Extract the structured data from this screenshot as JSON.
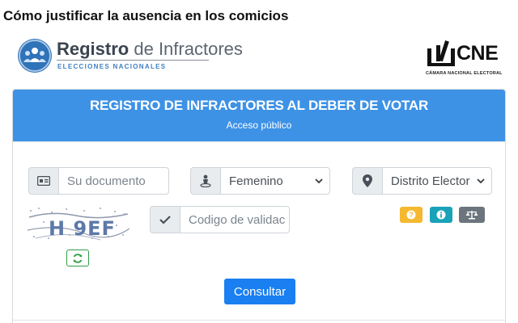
{
  "article": {
    "title": "Cómo justificar la ausencia en los comicios"
  },
  "logo_left": {
    "title_bold": "Registro",
    "title_rest": " de Infractores",
    "subtitle": "ELECCIONES NACIONALES",
    "icon": "people-group-icon"
  },
  "logo_right": {
    "title": "CNE",
    "subtitle": "CÁMARA NACIONAL ELECTORAL"
  },
  "card": {
    "title": "REGISTRO DE INFRACTORES AL DEBER DE VOTAR",
    "subtitle": "Acceso público"
  },
  "form": {
    "document": {
      "placeholder": "Su documento",
      "icon": "id-card-icon"
    },
    "gender": {
      "selected": "Femenino",
      "icon": "person-icon"
    },
    "district": {
      "selected": "Distrito Elector",
      "icon": "map-marker-icon"
    },
    "captcha": {
      "text": "H 9EF",
      "refresh_icon": "refresh-icon"
    },
    "code": {
      "placeholder": "Codigo de validac",
      "icon": "check-icon"
    },
    "help_buttons": [
      {
        "icon": "question-icon",
        "color": "#f5b82e"
      },
      {
        "icon": "info-icon",
        "color": "#1aa2b8"
      },
      {
        "icon": "balance-scale-icon",
        "color": "#6c757d"
      }
    ],
    "submit_label": "Consultar"
  },
  "colors": {
    "header": "#3d92e6",
    "button": "#1a7ff0",
    "refresh": "#2e9e44"
  }
}
